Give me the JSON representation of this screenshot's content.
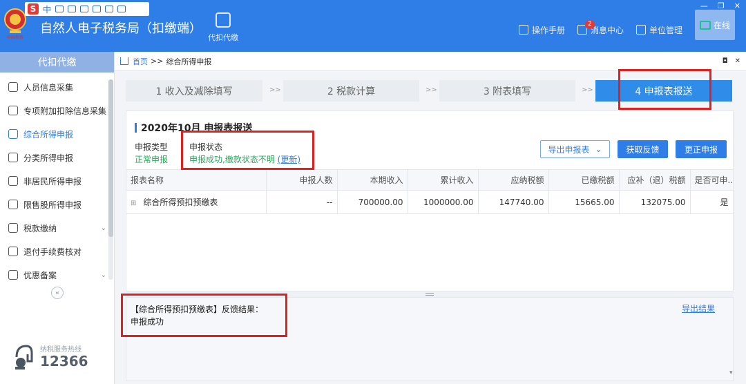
{
  "header": {
    "title": "自然人电子税务局（扣缴端）",
    "nav_agent": "代扣代缴",
    "manual": "操作手册",
    "messages": "消息中心",
    "messages_badge": "2",
    "unit_mgmt": "单位管理",
    "online": "在线",
    "ime_label": "中",
    "emblem_text": "中国税务"
  },
  "sidebar": {
    "title": "代扣代缴",
    "items": [
      {
        "label": "人员信息采集"
      },
      {
        "label": "专项附加扣除信息采集"
      },
      {
        "label": "综合所得申报"
      },
      {
        "label": "分类所得申报"
      },
      {
        "label": "非居民所得申报"
      },
      {
        "label": "限售股所得申报"
      },
      {
        "label": "税款缴纳"
      },
      {
        "label": "退付手续费核对"
      },
      {
        "label": "优惠备案"
      }
    ],
    "hotline_label": "纳税服务热线",
    "hotline_number": "12366"
  },
  "breadcrumb": {
    "home": "首页",
    "sep": ">>",
    "current": "综合所得申报"
  },
  "steps": [
    {
      "label": "1 收入及减除填写"
    },
    {
      "label": "2 税款计算"
    },
    {
      "label": "3 附表填写"
    },
    {
      "label": "4 申报表报送"
    }
  ],
  "step_sep": ">>",
  "panel": {
    "title": "2020年10月  申报表报送",
    "type_label": "申报类型",
    "type_value": "正常申报",
    "status_label": "申报状态",
    "status_value": "申报成功,缴款状态不明",
    "status_link": "(更新)",
    "btn_export": "导出申报表",
    "btn_feedback": "获取反馈",
    "btn_correct": "更正申报"
  },
  "table": {
    "headers": [
      "报表名称",
      "申报人数",
      "本期收入",
      "累计收入",
      "应纳税额",
      "已缴税额",
      "应补（退）税额",
      "是否可申..."
    ],
    "rows": [
      {
        "name": "综合所得预扣预缴表",
        "count": "--",
        "income": "700000.00",
        "cumulative": "1000000.00",
        "tax_due": "147740.00",
        "tax_paid": "15665.00",
        "tax_diff": "132075.00",
        "can_declare": "是"
      }
    ]
  },
  "feedback": {
    "line1": "【综合所得预扣预缴表】反馈结果：",
    "line2": "申报成功",
    "export": "导出结果"
  }
}
